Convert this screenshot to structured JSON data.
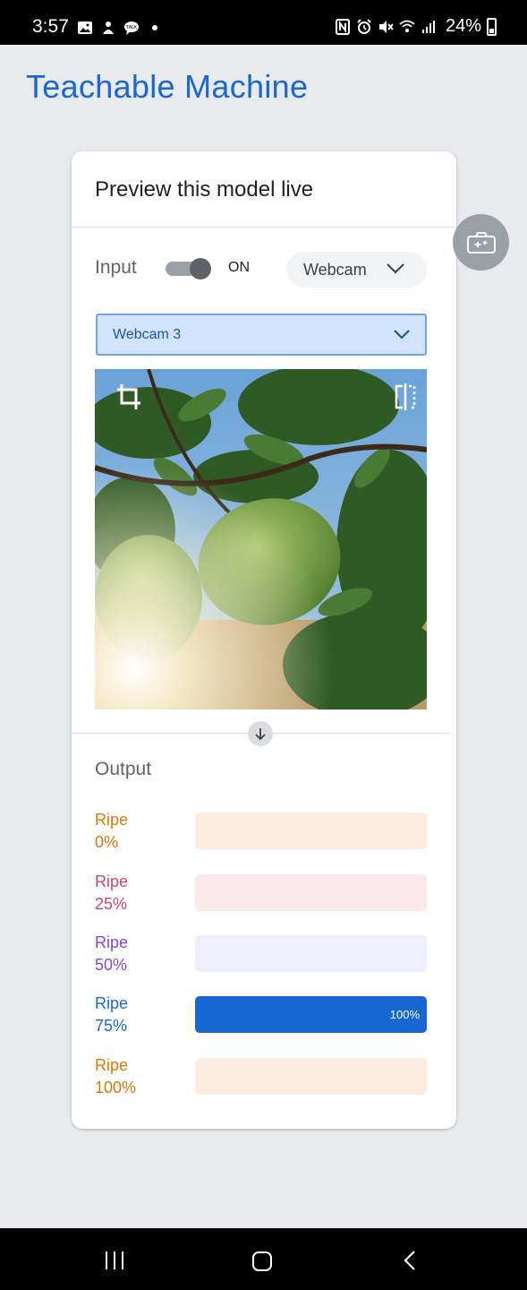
{
  "status_bar": {
    "time": "3:57",
    "battery": "24%",
    "left_icons": [
      "gallery-icon",
      "wellness-icon",
      "talk-icon",
      "dot-icon"
    ],
    "right_icons": [
      "nfc-icon",
      "alarm-icon",
      "mute-icon",
      "wifi-icon",
      "signal-icon",
      "battery-icon"
    ]
  },
  "app": {
    "title": "Teachable Machine"
  },
  "preview": {
    "title": "Preview this model live",
    "input_label": "Input",
    "toggle_state": "ON",
    "source_label": "Webcam",
    "webcam_device": "Webcam 3",
    "output_label": "Output"
  },
  "classes": [
    {
      "name": "Ripe",
      "pct": "0%",
      "confidence": 0,
      "value_text": "",
      "color": "#e37400",
      "track": "#fdebe0"
    },
    {
      "name": "Ripe",
      "pct": "25%",
      "confidence": 0,
      "value_text": "",
      "color": "#d0456b",
      "track": "#fce8ea"
    },
    {
      "name": "Ripe",
      "pct": "50%",
      "confidence": 0,
      "value_text": "",
      "color": "#8e44c9",
      "track": "#efeefc"
    },
    {
      "name": "Ripe",
      "pct": "75%",
      "confidence": 1.0,
      "value_text": "100%",
      "color": "#1967d2",
      "track": "#1967d2"
    },
    {
      "name": "Ripe",
      "pct": "100%",
      "confidence": 0,
      "value_text": "",
      "color": "#e37400",
      "track": "#fdebe0"
    }
  ],
  "colors": {
    "accent": "#1967d2",
    "background": "#e8eaed"
  }
}
